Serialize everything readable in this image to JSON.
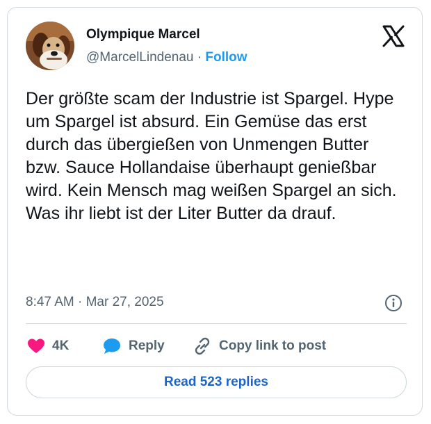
{
  "author": {
    "display_name": "Olympique Marcel",
    "handle": "@MarcelLindenau",
    "separator": "·",
    "follow_label": "Follow"
  },
  "tweet": {
    "text": "Der größte scam der Industrie ist Spargel. Hype um Spargel ist absurd. Ein Gemüse das erst durch das übergießen von Unmengen Butter bzw. Sauce Hollandaise überhaupt genießbar wird. Kein Mensch mag weißen Spargel an sich. Was ihr liebt ist der Liter Butter da drauf.",
    "timestamp": "8:47 AM · Mar 27, 2025"
  },
  "actions": {
    "likes_count": "4K",
    "reply_label": "Reply",
    "copy_link_label": "Copy link to post"
  },
  "footer": {
    "read_replies_label": "Read 523 replies"
  },
  "colors": {
    "accent": "#1d9bf0",
    "like": "#f91880",
    "reply_icon": "#1d9bf0",
    "read_button_text": "#1d64c8"
  },
  "icons": [
    "x-logo-icon",
    "info-icon",
    "heart-icon",
    "speech-bubble-icon",
    "link-icon"
  ]
}
